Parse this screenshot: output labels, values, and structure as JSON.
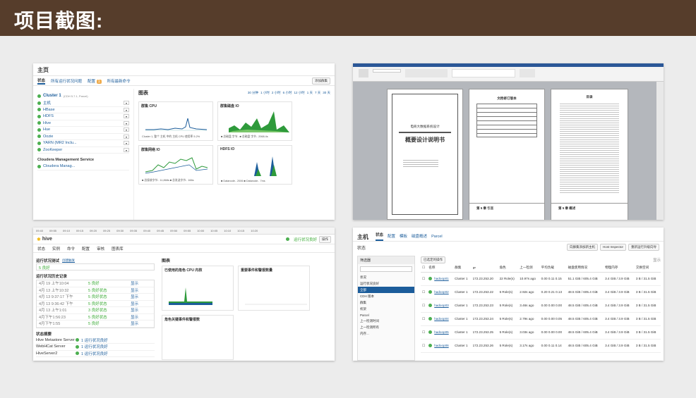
{
  "header": {
    "title": "项目截图:"
  },
  "cm": {
    "home": "主页",
    "tabs": [
      "状态",
      "所有运行状况问题",
      "配置",
      "所有最新命令"
    ],
    "config_badge": "1",
    "add_cluster": "添加群集",
    "cluster_name": "Cluster 1",
    "cluster_ver": "(CDH 5.7.1, Parcel)",
    "services": [
      "主机",
      "HBase",
      "HDFS",
      "Hive",
      "Hue",
      "Oozie",
      "YARN (MR2 Inclu...",
      "ZooKeeper"
    ],
    "mgmt_title": "Cloudera Management Service",
    "mgmt_item": "Cloudera Manag...",
    "charts_title": "图表",
    "time_ranges": [
      "30 分钟",
      "1 小时",
      "2 小时",
      "6 小时",
      "12 小时",
      "1 天",
      "7 天",
      "30 天"
    ],
    "charts": [
      {
        "title": "群集 CPU",
        "legend": "Cluster 1, 整个 主机 中的 主机 CPU 使用率  5.2%"
      },
      {
        "title": "群集磁盘 IO",
        "legend": "■ 总磁盘 字节..  ■ 总磁盘 字节..  2068.4s"
      },
      {
        "title": "群集网络 IO",
        "legend": "■ 总接收字节..  11,868s  ■ 总发送字节..  166s"
      },
      {
        "title": "HDFS IO",
        "legend": "■ Datanode.. 2006  ■ Datanode.. 7ms"
      }
    ]
  },
  "doc": {
    "cover_title": "电商大数据系统设计",
    "cover_subtitle": "概要设计说明书",
    "page2_title": "文档修订版本",
    "page3_title": "目录",
    "footer_labels": [
      "第 5 章 引言",
      "第 5 章 概述"
    ]
  },
  "hive": {
    "timeline": [
      "09:40",
      "09:55",
      "09:10",
      "09:15",
      "09:20",
      "09:25",
      "09:30",
      "09:35",
      "09:40",
      "09:45",
      "09:50",
      "09:55",
      "10:00",
      "10:05",
      "10:10",
      "10:15",
      "10:20"
    ],
    "name": "hive",
    "status_btn": "运行状况良好",
    "actions": "操作",
    "tabs": [
      "状态",
      "实例",
      "命令",
      "配置",
      "审核",
      "图表库"
    ],
    "health_tests_title": "运行状况测试",
    "create_trigger": "创建触发",
    "good_count": "5 良好",
    "history_title": "运行状况历史记录",
    "history": [
      {
        "time": "4月 19 上午10:04",
        "status": "5 良好",
        "link": "显示"
      },
      {
        "time": "4月 13 上午10:32",
        "status": "5 良好状态",
        "link": "显示"
      },
      {
        "time": "4月 13 9:37:17 下午",
        "status": "5 良好状态",
        "link": "显示"
      },
      {
        "time": "4月 13 9:36:42 下午",
        "status": "5 良好状态",
        "link": "显示"
      },
      {
        "time": "4月 13 上午1:01",
        "status": "3 良好状态",
        "link": "显示"
      },
      {
        "time": "4月下午1:56:23",
        "status": "5 良好状态",
        "link": "显示"
      },
      {
        "time": "4月下午1:55",
        "status": "5 良好",
        "link": "显示"
      }
    ],
    "summary_title": "状态摘要",
    "summary": [
      {
        "name": "Hive Metastore Server",
        "status": "1 运行状况良好"
      },
      {
        "name": "WebHCat Server",
        "status": "1 运行状况良好"
      },
      {
        "name": "HiveServer2",
        "status": "1 运行状况良好"
      }
    ],
    "charts_title": "图表",
    "charts": [
      "已使用的角色 CPU 内核",
      "重要事件和警报数量",
      "角色关键事件和警报数"
    ]
  },
  "hosts": {
    "title": "主机",
    "tabs": [
      "状态",
      "配置",
      "模板",
      "磁盘概述",
      "Parcel"
    ],
    "subtitle": "状态",
    "buttons": [
      "向群集添加新主机",
      "Host Inspector",
      "重新运行升级向导"
    ],
    "filter_label": "筛选器",
    "bulk_action": "已选定的操作",
    "display": "显示",
    "filter_groups": [
      "状况",
      "运行状况良好",
      "全部",
      "CDH 版本",
      "群集",
      "机架",
      "Parcel",
      "上一检测时间",
      "上一检测所有",
      "内存..."
    ],
    "columns": [
      "名称",
      "群集",
      "IP",
      "角色",
      "上一检测",
      "平均负载",
      "磁盘使用情况",
      "物理内存",
      "交换空间"
    ],
    "rows": [
      {
        "name": "hadoop01",
        "cluster": "Cluster 1",
        "ip": "172.23.253.20",
        "roles": "22 Role(s)",
        "heartbeat": "10.97s ago",
        "load": "0.00 0.11 0.15",
        "disk": "51.1 GiB / 605.4 GiB",
        "mem": "3.4 GiB / 3.9 GiB",
        "swap": "3 B / 31.5 GiB"
      },
      {
        "name": "hadoop02",
        "cluster": "Cluster 1",
        "ip": "172.23.253.22",
        "roles": "5 Role(s)",
        "heartbeat": "2.92s ago",
        "load": "0.20 0.21 0.13",
        "disk": "48.5 GiB / 605.4 GiB",
        "mem": "3.4 GiB / 3.9 GiB",
        "swap": "3 B / 31.5 GiB"
      },
      {
        "name": "hadoop03",
        "cluster": "Cluster 1",
        "ip": "172.23.253.23",
        "roles": "5 Role(s)",
        "heartbeat": "3.46s ago",
        "load": "0.00 0.00 0.00",
        "disk": "48.5 GiB / 605.4 GiB",
        "mem": "3.4 GiB / 3.9 GiB",
        "swap": "3 B / 31.5 GiB"
      },
      {
        "name": "hadoop04",
        "cluster": "Cluster 1",
        "ip": "172.23.253.24",
        "roles": "5 Role(s)",
        "heartbeat": "2.79s ago",
        "load": "0.00 0.00 0.05",
        "disk": "48.5 GiB / 605.4 GiB",
        "mem": "3.4 GiB / 3.9 GiB",
        "swap": "3 B / 31.5 GiB"
      },
      {
        "name": "hadoop05",
        "cluster": "Cluster 1",
        "ip": "172.23.253.25",
        "roles": "5 Role(s)",
        "heartbeat": "3.03s ago",
        "load": "0.00 0.00 0.00",
        "disk": "48.5 GiB / 605.4 GiB",
        "mem": "3.4 GiB / 3.9 GiB",
        "swap": "3 B / 31.5 GiB"
      },
      {
        "name": "hadoop06",
        "cluster": "Cluster 1",
        "ip": "172.23.253.26",
        "roles": "5 Role(s)",
        "heartbeat": "3.17s ago",
        "load": "0.00 0.11 0.14",
        "disk": "48.5 GiB / 605.4 GiB",
        "mem": "3.4 GiB / 3.9 GiB",
        "swap": "3 B / 31.5 GiB"
      }
    ]
  }
}
